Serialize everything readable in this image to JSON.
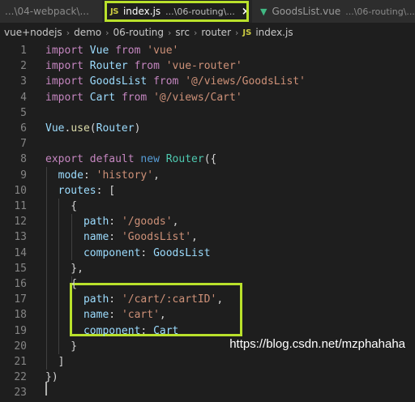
{
  "tabs": [
    {
      "name": "...\\04-webpack\\...",
      "active": false
    },
    {
      "icon": "JS",
      "name": "index.js",
      "desc": "...\\06-routing\\...",
      "close": "×",
      "active": true
    },
    {
      "icon": "V",
      "name": "GoodsList.vue",
      "desc": "...\\06-routing\\...",
      "active": false
    }
  ],
  "breadcrumb": {
    "segments": [
      "vue+nodejs",
      "demo",
      "06-routing",
      "src",
      "router"
    ],
    "file_icon": "JS",
    "file": "index.js",
    "separator": "›"
  },
  "code_lines": [
    {
      "n": "1",
      "tokens": [
        [
          "kw2",
          "import"
        ],
        [
          "pun",
          " "
        ],
        [
          "id",
          "Vue"
        ],
        [
          "pun",
          " "
        ],
        [
          "kw2",
          "from"
        ],
        [
          "pun",
          " "
        ],
        [
          "str",
          "'vue'"
        ]
      ]
    },
    {
      "n": "2",
      "tokens": [
        [
          "kw2",
          "import"
        ],
        [
          "pun",
          " "
        ],
        [
          "id",
          "Router"
        ],
        [
          "pun",
          " "
        ],
        [
          "kw2",
          "from"
        ],
        [
          "pun",
          " "
        ],
        [
          "str",
          "'vue-router'"
        ]
      ]
    },
    {
      "n": "3",
      "tokens": [
        [
          "kw2",
          "import"
        ],
        [
          "pun",
          " "
        ],
        [
          "id",
          "GoodsList"
        ],
        [
          "pun",
          " "
        ],
        [
          "kw2",
          "from"
        ],
        [
          "pun",
          " "
        ],
        [
          "str",
          "'@/views/GoodsList'"
        ]
      ]
    },
    {
      "n": "4",
      "tokens": [
        [
          "kw2",
          "import"
        ],
        [
          "pun",
          " "
        ],
        [
          "id",
          "Cart"
        ],
        [
          "pun",
          " "
        ],
        [
          "kw2",
          "from"
        ],
        [
          "pun",
          " "
        ],
        [
          "str",
          "'@/views/Cart'"
        ]
      ]
    },
    {
      "n": "5",
      "tokens": []
    },
    {
      "n": "6",
      "tokens": [
        [
          "id",
          "Vue"
        ],
        [
          "pun",
          "."
        ],
        [
          "fn",
          "use"
        ],
        [
          "pun",
          "("
        ],
        [
          "id",
          "Router"
        ],
        [
          "pun",
          ")"
        ]
      ]
    },
    {
      "n": "7",
      "tokens": []
    },
    {
      "n": "8",
      "tokens": [
        [
          "kw2",
          "export"
        ],
        [
          "pun",
          " "
        ],
        [
          "kw2",
          "default"
        ],
        [
          "pun",
          " "
        ],
        [
          "kw",
          "new"
        ],
        [
          "pun",
          " "
        ],
        [
          "cls",
          "Router"
        ],
        [
          "pun",
          "({"
        ]
      ]
    },
    {
      "n": "9",
      "tokens": [
        [
          "pun",
          "  "
        ],
        [
          "id",
          "mode"
        ],
        [
          "pun",
          ": "
        ],
        [
          "str",
          "'history'"
        ],
        [
          "pun",
          ","
        ]
      ]
    },
    {
      "n": "10",
      "tokens": [
        [
          "pun",
          "  "
        ],
        [
          "id",
          "routes"
        ],
        [
          "pun",
          ": ["
        ]
      ]
    },
    {
      "n": "11",
      "tokens": [
        [
          "pun",
          "    {"
        ]
      ]
    },
    {
      "n": "12",
      "tokens": [
        [
          "pun",
          "      "
        ],
        [
          "id",
          "path"
        ],
        [
          "pun",
          ": "
        ],
        [
          "str",
          "'/goods'"
        ],
        [
          "pun",
          ","
        ]
      ]
    },
    {
      "n": "13",
      "tokens": [
        [
          "pun",
          "      "
        ],
        [
          "id",
          "name"
        ],
        [
          "pun",
          ": "
        ],
        [
          "str",
          "'GoodsList'"
        ],
        [
          "pun",
          ","
        ]
      ]
    },
    {
      "n": "14",
      "tokens": [
        [
          "pun",
          "      "
        ],
        [
          "id",
          "component"
        ],
        [
          "pun",
          ": "
        ],
        [
          "id",
          "GoodsList"
        ]
      ]
    },
    {
      "n": "15",
      "tokens": [
        [
          "pun",
          "    },"
        ]
      ]
    },
    {
      "n": "16",
      "tokens": [
        [
          "pun",
          "    {"
        ]
      ]
    },
    {
      "n": "17",
      "tokens": [
        [
          "pun",
          "      "
        ],
        [
          "id",
          "path"
        ],
        [
          "pun",
          ": "
        ],
        [
          "str",
          "'/cart/:cartID'"
        ],
        [
          "pun",
          ","
        ]
      ]
    },
    {
      "n": "18",
      "tokens": [
        [
          "pun",
          "      "
        ],
        [
          "id",
          "name"
        ],
        [
          "pun",
          ": "
        ],
        [
          "str",
          "'cart'"
        ],
        [
          "pun",
          ","
        ]
      ]
    },
    {
      "n": "19",
      "tokens": [
        [
          "pun",
          "      "
        ],
        [
          "id",
          "component"
        ],
        [
          "pun",
          ": "
        ],
        [
          "id",
          "Cart"
        ]
      ]
    },
    {
      "n": "20",
      "tokens": [
        [
          "pun",
          "    }"
        ]
      ]
    },
    {
      "n": "21",
      "tokens": [
        [
          "pun",
          "  ]"
        ]
      ]
    },
    {
      "n": "22",
      "tokens": [
        [
          "pun",
          "})"
        ]
      ]
    },
    {
      "n": "23",
      "tokens": []
    }
  ],
  "watermark": "https://blog.csdn.net/mzphahaha",
  "colors": {
    "highlight_box": "#b9e12b",
    "keyword_import": "#c586c0",
    "keyword_new": "#569cd6",
    "string": "#ce9178",
    "identifier": "#9cdcfe",
    "function": "#dcdcaa",
    "class": "#4ec9b0",
    "line_number": "#858585",
    "background": "#1e1e1e"
  }
}
